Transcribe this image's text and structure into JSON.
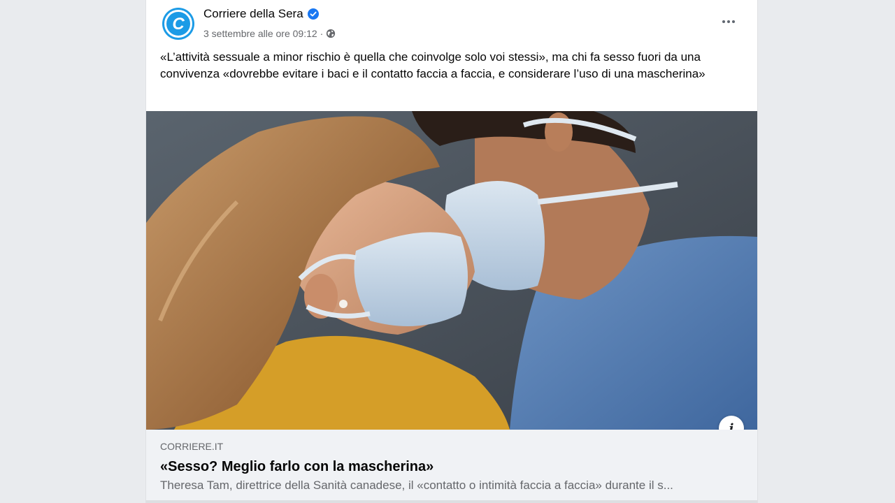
{
  "post": {
    "page_name": "Corriere della Sera",
    "avatar_letter": "C",
    "timestamp": "3 settembre alle ore 09:12",
    "separator": "·",
    "privacy_icon": "globe-icon",
    "verified_icon": "verified-badge-icon",
    "more_icon": "more-options-icon",
    "text": "«L’attività sessuale a minor rischio è quella che coinvolge solo voi stessi», ma chi fa sesso fuori da una convivenza «dovrebbe evitare i baci e il contatto faccia a faccia, e considerare l’uso di una mascherina»"
  },
  "link": {
    "domain": "CORRIERE.IT",
    "title": "«Sesso? Meglio farlo con la mascherina»",
    "description": "Theresa Tam, direttrice della Sanità canadese, il «contatto o intimità faccia a faccia» durante il s...",
    "info_label": "i"
  },
  "colors": {
    "brand_blue": "#1877f2",
    "avatar_blue": "#1c9be6",
    "text_primary": "#050505",
    "text_secondary": "#65676b",
    "preview_bg": "#f0f2f5"
  }
}
